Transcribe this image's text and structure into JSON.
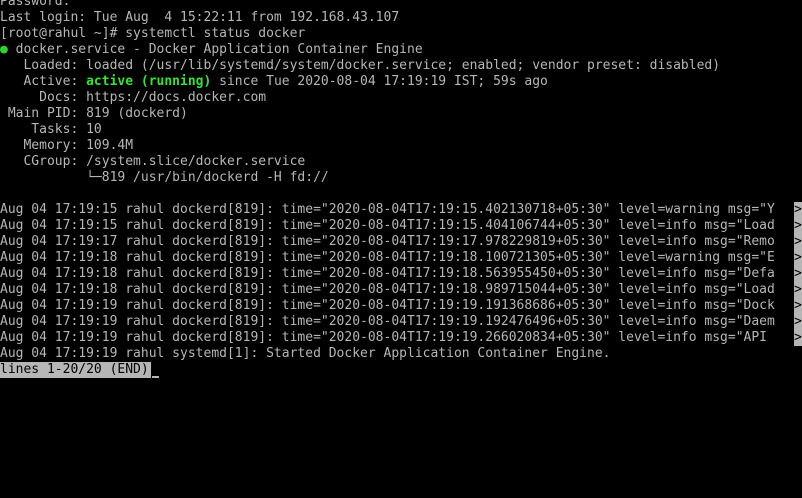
{
  "terminal": {
    "colors": {
      "background": "#000000",
      "foreground": "#b6b6b6",
      "active_green": "#34e334",
      "unit_dot": "#2fd12f"
    },
    "header_lines": [
      "Password:",
      "Last login: Tue Aug  4 15:22:11 from 192.168.43.107",
      "[root@rahul ~]# systemctl status docker"
    ],
    "unit": {
      "dot": "●",
      "title": " docker.service - Docker Application Container Engine",
      "loaded": "   Loaded: loaded (/usr/lib/systemd/system/docker.service; enabled; vendor preset: disabled)",
      "active_label": "   Active: ",
      "active_state": "active (running)",
      "active_since": " since Tue 2020-08-04 17:19:19 IST; 59s ago",
      "docs": "     Docs: https://docs.docker.com",
      "main_pid": " Main PID: 819 (dockerd)",
      "tasks": "    Tasks: 10",
      "memory": "   Memory: 109.4M",
      "cgroup": "   CGroup: /system.slice/docker.service",
      "cgroup_child": "           └─819 /usr/bin/dockerd -H fd://"
    },
    "log_lines": [
      "Aug 04 17:19:15 rahul dockerd[819]: time=\"2020-08-04T17:19:15.402130718+05:30\" level=warning msg=\"Y",
      "Aug 04 17:19:15 rahul dockerd[819]: time=\"2020-08-04T17:19:15.404106744+05:30\" level=info msg=\"Load",
      "Aug 04 17:19:17 rahul dockerd[819]: time=\"2020-08-04T17:19:17.978229819+05:30\" level=info msg=\"Remo",
      "Aug 04 17:19:18 rahul dockerd[819]: time=\"2020-08-04T17:19:18.100721305+05:30\" level=warning msg=\"E",
      "Aug 04 17:19:18 rahul dockerd[819]: time=\"2020-08-04T17:19:18.563955450+05:30\" level=info msg=\"Defa",
      "Aug 04 17:19:18 rahul dockerd[819]: time=\"2020-08-04T17:19:18.989715044+05:30\" level=info msg=\"Load",
      "Aug 04 17:19:19 rahul dockerd[819]: time=\"2020-08-04T17:19:19.191368686+05:30\" level=info msg=\"Dock",
      "Aug 04 17:19:19 rahul dockerd[819]: time=\"2020-08-04T17:19:19.192476496+05:30\" level=info msg=\"Daem",
      "Aug 04 17:19:19 rahul dockerd[819]: time=\"2020-08-04T17:19:19.266020834+05:30\" level=info msg=\"API "
    ],
    "truncation_marker": ">",
    "final_log_line": "Aug 04 17:19:19 rahul systemd[1]: Started Docker Application Container Engine.",
    "pager_status": "lines 1-20/20 (END)"
  }
}
